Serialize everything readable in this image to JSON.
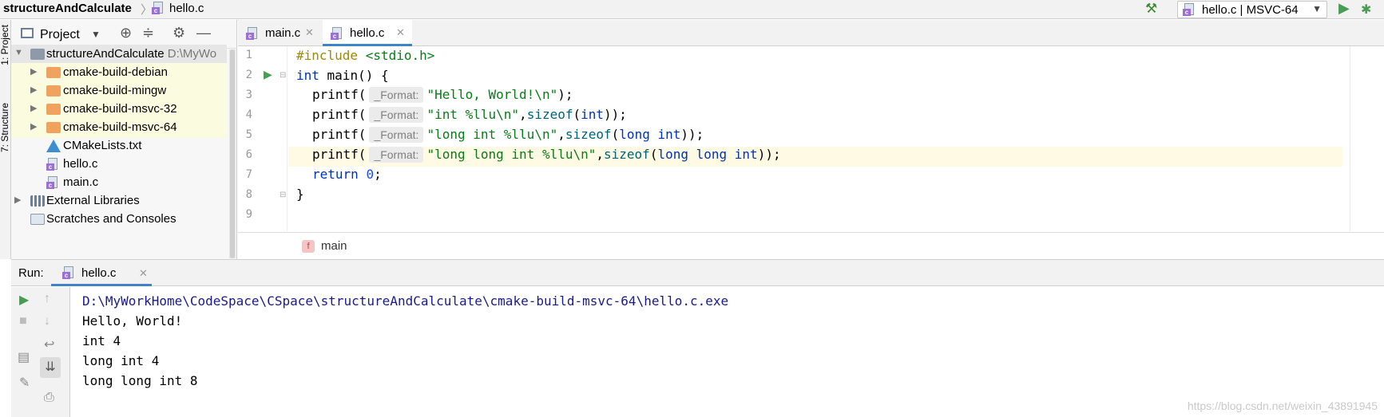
{
  "titlebar": {
    "project": "structureAndCalculate",
    "separator": "〉",
    "file": "hello.c",
    "run_config": "hello.c | MSVC-64"
  },
  "side_tabs": {
    "project": "1: Project",
    "structure": "7: Structure"
  },
  "project_panel": {
    "title": "Project",
    "tree": [
      {
        "label": "structureAndCalculate",
        "path": "D:\\MyWo",
        "type": "root-folder"
      },
      {
        "label": "cmake-build-debian",
        "type": "build-folder"
      },
      {
        "label": "cmake-build-mingw",
        "type": "build-folder"
      },
      {
        "label": "cmake-build-msvc-32",
        "type": "build-folder"
      },
      {
        "label": "cmake-build-msvc-64",
        "type": "build-folder"
      },
      {
        "label": "CMakeLists.txt",
        "type": "cmake-file"
      },
      {
        "label": "hello.c",
        "type": "c-file"
      },
      {
        "label": "main.c",
        "type": "c-file"
      },
      {
        "label": "External Libraries",
        "type": "libraries"
      },
      {
        "label": "Scratches and Consoles",
        "type": "scratches"
      }
    ]
  },
  "editor": {
    "tabs": [
      {
        "label": "main.c",
        "active": false
      },
      {
        "label": "hello.c",
        "active": true
      }
    ],
    "line_numbers": [
      "1",
      "2",
      "3",
      "4",
      "5",
      "6",
      "7",
      "8",
      "9"
    ],
    "hint_label": "_Format:",
    "code": {
      "l1_pp": "#include",
      "l1_hdr": " <stdio.h>",
      "l2_kw": "int",
      "l2_rest": " main() {",
      "printf": "printf(",
      "l3_str": "\"Hello, World!\\n\"",
      "l3_end": ");",
      "l4_str": "\"int %llu\\n\"",
      "l4_sizeof": "sizeof",
      "l4_open": "(",
      "l4_type": "int",
      "l4_end": "));",
      "l5_str": "\"long int %llu\\n\"",
      "l5_type": "long int",
      "l6_str": "\"long long int %llu\\n\"",
      "l6_type": "long long int",
      "comma": ",",
      "l7_kw": "return",
      "l7_num": "0",
      "l7_end": ";",
      "l8": "}"
    },
    "breadcrumb_fn": "main",
    "breadcrumb_f": "f"
  },
  "run_panel": {
    "label": "Run:",
    "tab": "hello.c",
    "output": [
      "D:\\MyWorkHome\\CodeSpace\\CSpace\\structureAndCalculate\\cmake-build-msvc-64\\hello.c.exe",
      "Hello, World!",
      "int 4",
      "long int 4",
      "long long int 8"
    ]
  },
  "watermark": "https://blog.csdn.net/weixin_43891945",
  "colors": {
    "accent": "#4083c9",
    "run_green": "#499c54",
    "folder_orange": "#f0a35e",
    "keyword": "#0033b3",
    "string": "#067d17"
  }
}
